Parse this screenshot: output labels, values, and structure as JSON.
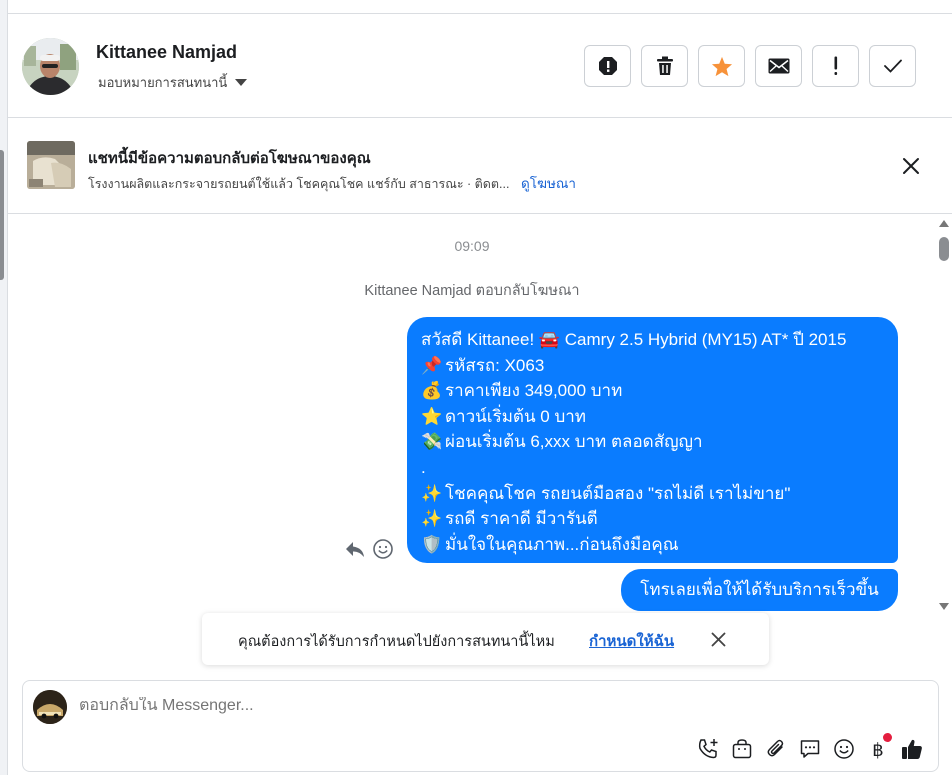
{
  "header": {
    "contact_name": "Kittanee Namjad",
    "assign_label": "มอบหมายการสนทนานี้"
  },
  "actions": [
    "spam-icon",
    "trash-icon",
    "star-icon",
    "mail-icon",
    "exclamation-icon",
    "check-icon"
  ],
  "ad": {
    "title": "แชทนี้มีข้อความตอบกลับต่อโฆษณาของคุณ",
    "subtitle": "โรงงานผลิตและกระจายรถยนต์ใช้แล้ว โชคคุณโชค แชร์กับ สาธารณะ · ติดต...",
    "link": "ดูโฆษณา"
  },
  "chat": {
    "timestamp": "09:09",
    "reply_note": "Kittanee Namjad ตอบกลับโฆษณา",
    "message_lines": [
      {
        "emoji": "",
        "text": "สวัสดี Kittanee! 🚘 Camry 2.5 Hybrid (MY15) AT* ปี 2015"
      },
      {
        "emoji": "📌",
        "text": "รหัสรถ: X063"
      },
      {
        "emoji": "💰",
        "text": "ราคาเพียง 349,000 บาท"
      },
      {
        "emoji": "⭐",
        "text": "ดาวน์เริ่มต้น 0 บาท"
      },
      {
        "emoji": "💸",
        "text": "ผ่อนเริ่มต้น 6,xxx บาท ตลอดสัญญา"
      },
      {
        "emoji": "",
        "text": "."
      },
      {
        "emoji": "✨",
        "text": "โชคคุณโชค รถยนต์มือสอง \"รถไม่ดี เราไม่ขาย\""
      },
      {
        "emoji": "✨",
        "text": "รถดี ราคาดี มีวารันตี"
      },
      {
        "emoji": "🛡️",
        "text": "มั่นใจในคุณภาพ...ก่อนถึงมือคุณ"
      }
    ],
    "message_2": "โทรเลยเพื่อให้ได้รับบริการเร็วขึ้น"
  },
  "toast": {
    "text": "คุณต้องการได้รับการกำหนดไปยังการสนทนานี้ไหม",
    "link": "กำหนดให้ฉัน"
  },
  "composer": {
    "placeholder": "ตอบกลับใน Messenger..."
  },
  "composer_tools": [
    "call-add-icon",
    "shop-bag-icon",
    "attachment-icon",
    "chat-reply-icon",
    "emoji-icon",
    "baht-payment-icon",
    "thumbs-up-icon"
  ],
  "colors": {
    "bubble": "#0a7cff",
    "link": "#1a64d4",
    "accent_star": "#f7923a",
    "notification_dot": "#e41e3f"
  }
}
